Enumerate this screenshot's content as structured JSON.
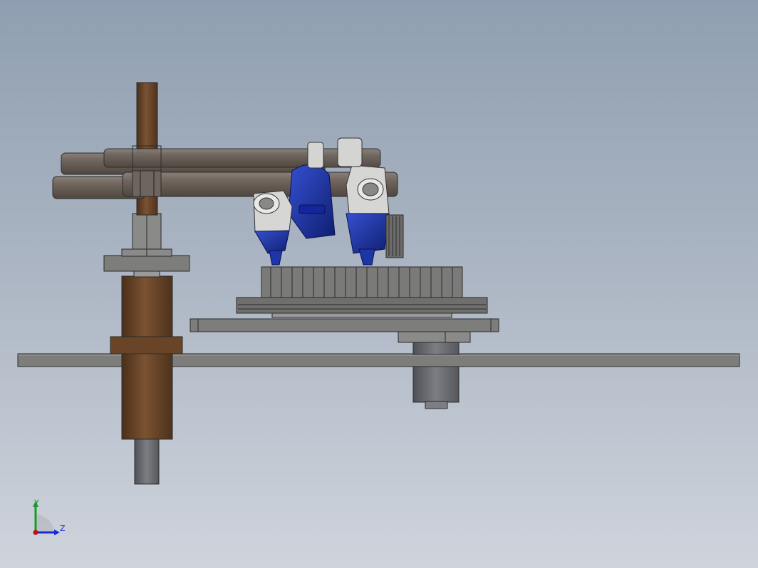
{
  "viewport": {
    "background_top": "#8f9fb1",
    "background_bottom": "#cfd4dc"
  },
  "colors": {
    "bronze": "#6b4628",
    "bronze_dark": "#4a2f1a",
    "tube": "#6f655d",
    "tube_light": "#8a8078",
    "steel": "#8a8a88",
    "steel_dark": "#5a5a58",
    "plate": "#7f7f7d",
    "motor_blue": "#1e35a8",
    "motor_blue_dark": "#0f1f70",
    "clamp": "#d8d8d6"
  },
  "triad": {
    "y_label": "Y",
    "z_label": "Z",
    "y_color": "#1a9a2a",
    "z_color": "#1a2ad0",
    "origin_color": "#c01010"
  }
}
